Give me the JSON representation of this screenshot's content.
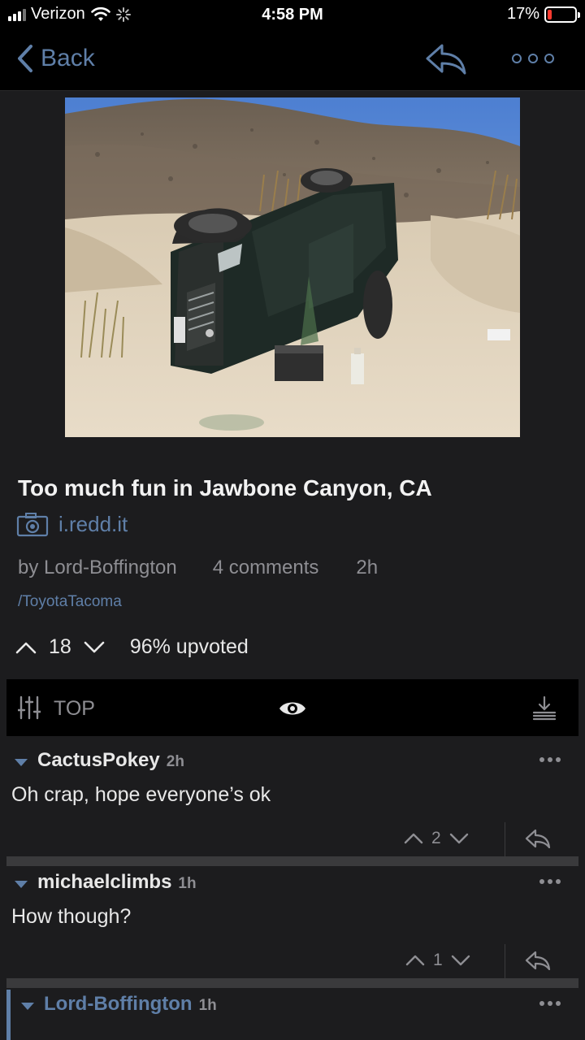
{
  "status_bar": {
    "carrier": "Verizon",
    "time": "4:58 PM",
    "battery_percent": "17%",
    "battery_level": 0.17,
    "icons": [
      "signal-icon",
      "wifi-icon",
      "loading-icon",
      "battery-icon"
    ]
  },
  "nav": {
    "back_label": "Back",
    "icons": [
      "chevron-left-icon",
      "reply-icon",
      "more-icon"
    ]
  },
  "post": {
    "title": "Too much fun in Jawbone Canyon, CA",
    "domain": "i.redd.it",
    "author": "by Lord-Boffington",
    "comments": "4 comments",
    "age": "2h",
    "subreddit": "/ToyotaTacoma",
    "score": "18",
    "upvoted": "96% upvoted"
  },
  "sort": {
    "label": "TOP",
    "icons": [
      "sliders-icon",
      "eye-icon",
      "download-icon"
    ]
  },
  "comments": [
    {
      "author": "CactusPokey",
      "age": "2h",
      "text": "Oh crap, hope everyone’s ok",
      "score": "2"
    },
    {
      "author": "michaelclimbs",
      "age": "1h",
      "text": "How though?",
      "score": "1"
    },
    {
      "author": "Lord-Boffington",
      "age": "1h",
      "text": ""
    }
  ],
  "colors": {
    "accent": "#5f7fa8",
    "background": "#1c1c1e",
    "bar": "#000000",
    "muted": "#8e8e93"
  }
}
